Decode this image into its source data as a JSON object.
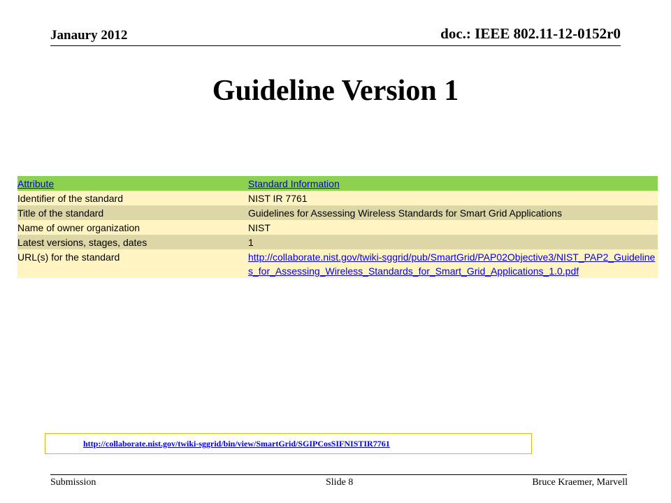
{
  "header": {
    "date": "Janaury 2012",
    "doc_id": "doc.: IEEE 802.11-12-0152r0"
  },
  "title": "Guideline Version 1",
  "table": {
    "header": {
      "attribute": "Attribute",
      "info": "Standard Information"
    },
    "rows": [
      {
        "attribute": "Identifier of the standard",
        "value": "NIST IR 7761"
      },
      {
        "attribute": "Title of the standard",
        "value": "Guidelines for Assessing Wireless Standards for Smart Grid Applications"
      },
      {
        "attribute": "Name of owner organization",
        "value": "NIST"
      },
      {
        "attribute": "Latest versions, stages, dates",
        "value": "1"
      },
      {
        "attribute": "URL(s) for the standard",
        "value": "http://collaborate.nist.gov/twiki-sggrid/pub/SmartGrid/PAP02Objective3/NIST_PAP2_Guidelines_for_Assessing_Wireless_Standards_for_Smart_Grid_Applications_1.0.pdf"
      }
    ]
  },
  "bottom_link": "http://collaborate.nist.gov/twiki-sggrid/bin/view/SmartGrid/SGIPCosSIFNISTIR7761",
  "footer": {
    "left": "Submission",
    "center": "Slide 8",
    "right": "Bruce Kraemer, Marvell"
  }
}
